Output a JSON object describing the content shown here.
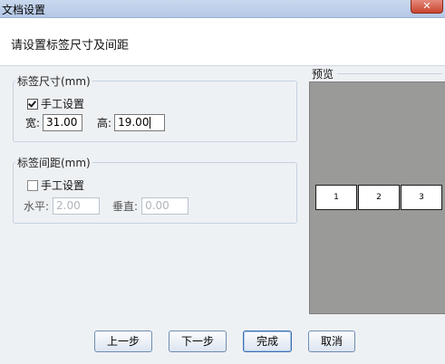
{
  "window": {
    "title": "文档设置",
    "close_label": "✕"
  },
  "header": {
    "heading": "请设置标签尺寸及间距"
  },
  "size_group": {
    "legend": "标签尺寸(mm)",
    "manual_label": "手工设置",
    "manual_checked": true,
    "width_label": "宽:",
    "width_value": "31.00",
    "height_label": "高:",
    "height_value": "19.00"
  },
  "spacing_group": {
    "legend": "标签间距(mm)",
    "manual_label": "手工设置",
    "manual_checked": false,
    "horizontal_label": "水平:",
    "horizontal_value": "2.00",
    "vertical_label": "垂直:",
    "vertical_value": "0.00"
  },
  "preview": {
    "title": "预览",
    "labels": [
      "1",
      "2",
      "3"
    ],
    "background_color": "#9a9a98"
  },
  "buttons": {
    "prev": "上一步",
    "next": "下一步",
    "finish": "完成",
    "cancel": "取消"
  }
}
